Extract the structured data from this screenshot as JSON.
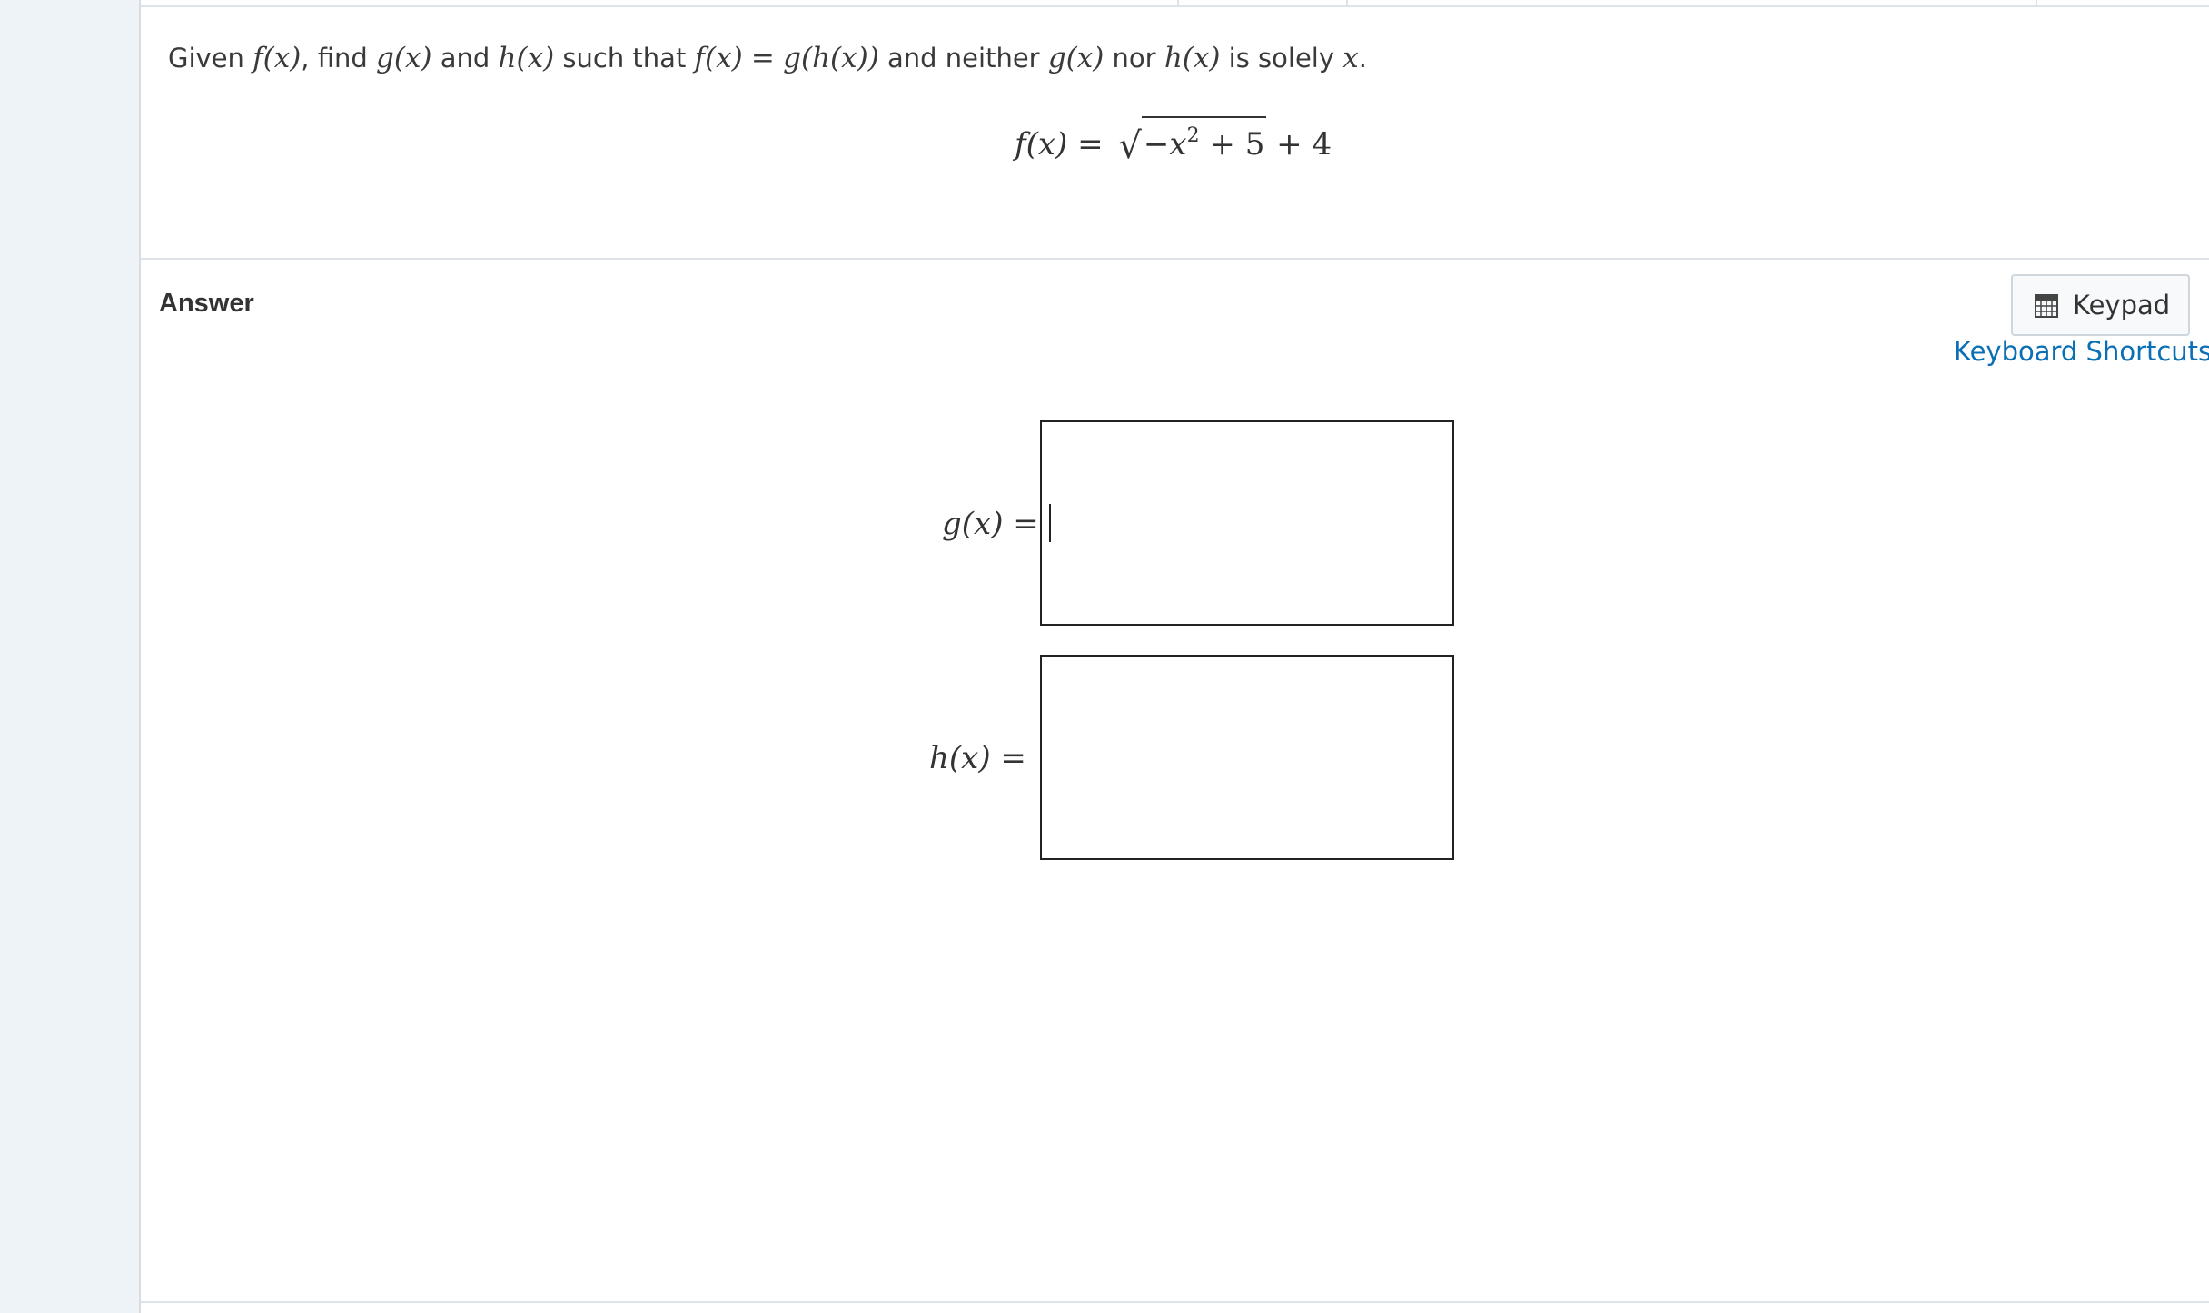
{
  "question": {
    "given": "Given",
    "f_of_x": "f(x)",
    "find": ", find",
    "g_of_x": "g(x)",
    "and": "and",
    "h_of_x": "h(x)",
    "such_that": "such that",
    "composition_lhs": "f(x)",
    "equals": "=",
    "composition_rhs": "g(h(x))",
    "and_neither": "and neither",
    "g_of_x_2": "g(x)",
    "nor": "nor",
    "h_of_x_2": "h(x)",
    "is_solely": "is solely",
    "x_var": "x",
    "period": "."
  },
  "formula": {
    "lhs": "f(x)",
    "equals": "=",
    "radical_sign": "√",
    "radicand_pre": "−x",
    "exponent": "2",
    "radicand_post": " + 5",
    "tail": "+ 4"
  },
  "answer": {
    "heading": "Answer",
    "keypad_label": "Keypad",
    "keyboard_shortcuts": "Keyboard Shortcuts",
    "g_label": "g(x) =",
    "h_label": "h(x) =",
    "g_value": "",
    "h_value": ""
  },
  "icons": {
    "keypad": "calculator-grid-icon"
  },
  "colors": {
    "link": "#0a6fb5",
    "background": "#eef3f7",
    "panel": "#ffffff"
  }
}
